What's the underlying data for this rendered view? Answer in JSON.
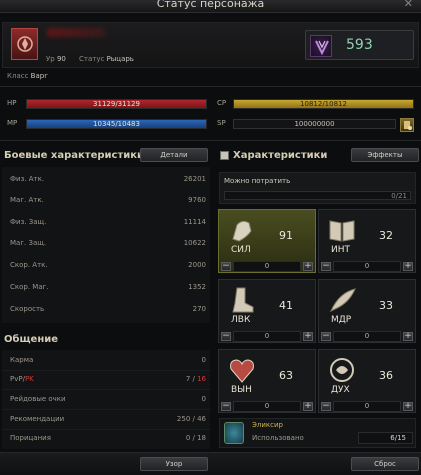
{
  "window": {
    "title": "Статус персонажа",
    "close": "✕"
  },
  "character": {
    "level_label": "Ур",
    "level": "90",
    "status_label": "Статус",
    "status": "Рыцарь",
    "class_label": "Класс",
    "class": "Варг",
    "power": "593"
  },
  "bars": {
    "hp_label": "HP",
    "hp_text": "31129/31129",
    "hp_fraction": 1.0,
    "mp_label": "MP",
    "mp_text": "10345/10483",
    "mp_fraction": 0.987,
    "cp_label": "CP",
    "cp_text": "10812/10812",
    "cp_fraction": 1.0,
    "sp_label": "SP",
    "sp_text": "100000000"
  },
  "combat": {
    "title": "Боевые характеристики",
    "details_button": "Детали",
    "rows": [
      {
        "label": "Физ. Атк.",
        "value": "26201"
      },
      {
        "label": "Маг. Атк.",
        "value": "9760"
      },
      {
        "label": "Физ. Защ.",
        "value": "11114"
      },
      {
        "label": "Маг. Защ.",
        "value": "10622"
      },
      {
        "label": "Скор. Атк.",
        "value": "2000"
      },
      {
        "label": "Скор. Маг.",
        "value": "1352"
      },
      {
        "label": "Скорость",
        "value": "270"
      }
    ]
  },
  "social": {
    "title": "Общение",
    "rows": [
      {
        "label": "Карма",
        "value": "0"
      },
      {
        "label_a": "PvP/",
        "label_b": "PK",
        "value_a": "7 / ",
        "value_b": "16"
      },
      {
        "label": "Рейдовые очки",
        "value": "0"
      },
      {
        "label": "Рекомендации",
        "value": "250 / 46"
      },
      {
        "label": "Порицания",
        "value": "0 / 18"
      }
    ]
  },
  "attributes": {
    "title": "Характеристики",
    "effects_button": "Эффекты",
    "spend_label": "Можно потратить",
    "spend_value": "0/21",
    "items": [
      {
        "abbr": "СИЛ",
        "value": "91",
        "alloc": "0",
        "icon": "fist-icon"
      },
      {
        "abbr": "ИНТ",
        "value": "32",
        "alloc": "0",
        "icon": "book-icon"
      },
      {
        "abbr": "ЛВК",
        "value": "41",
        "alloc": "0",
        "icon": "boot-icon"
      },
      {
        "abbr": "МДР",
        "value": "33",
        "alloc": "0",
        "icon": "feather-icon"
      },
      {
        "abbr": "ВЫН",
        "value": "63",
        "alloc": "0",
        "icon": "heart-icon"
      },
      {
        "abbr": "ДУХ",
        "value": "36",
        "alloc": "0",
        "icon": "spirit-icon"
      }
    ]
  },
  "elixir": {
    "name": "Эликсир",
    "used_label": "Использовано",
    "count": "6/15"
  },
  "footer": {
    "view_button": "Узор",
    "reset_button": "Сброс"
  }
}
